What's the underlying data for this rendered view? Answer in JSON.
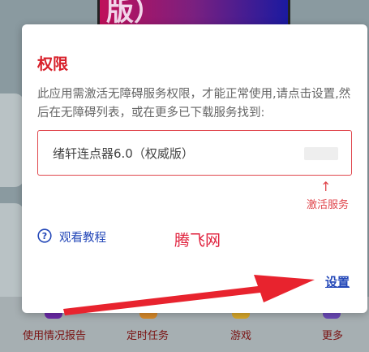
{
  "background": {
    "banner_text": "版）",
    "tabs": [
      {
        "label": "使用情况报告"
      },
      {
        "label": "定时任务"
      },
      {
        "label": "游戏"
      },
      {
        "label": "更多"
      }
    ]
  },
  "dialog": {
    "title": "权限",
    "message": "此应用需激活无障碍服务权限，才能正常使用,请点击设置,然后在无障碍列表，或在更多已下载服务找到:",
    "service_name": "绪轩连点器6.0（权威版）",
    "up_arrow": "↑",
    "activate_hint": "激活服务",
    "tutorial_label": "观看教程",
    "watermark": "腾飞网",
    "settings_label": "设置"
  },
  "colors": {
    "accent_red": "#e0474d",
    "title_red": "#d8202a",
    "link_blue": "#2347b8",
    "arrow_red": "#e8232e"
  },
  "icons": {
    "help": "question-circle-icon"
  }
}
